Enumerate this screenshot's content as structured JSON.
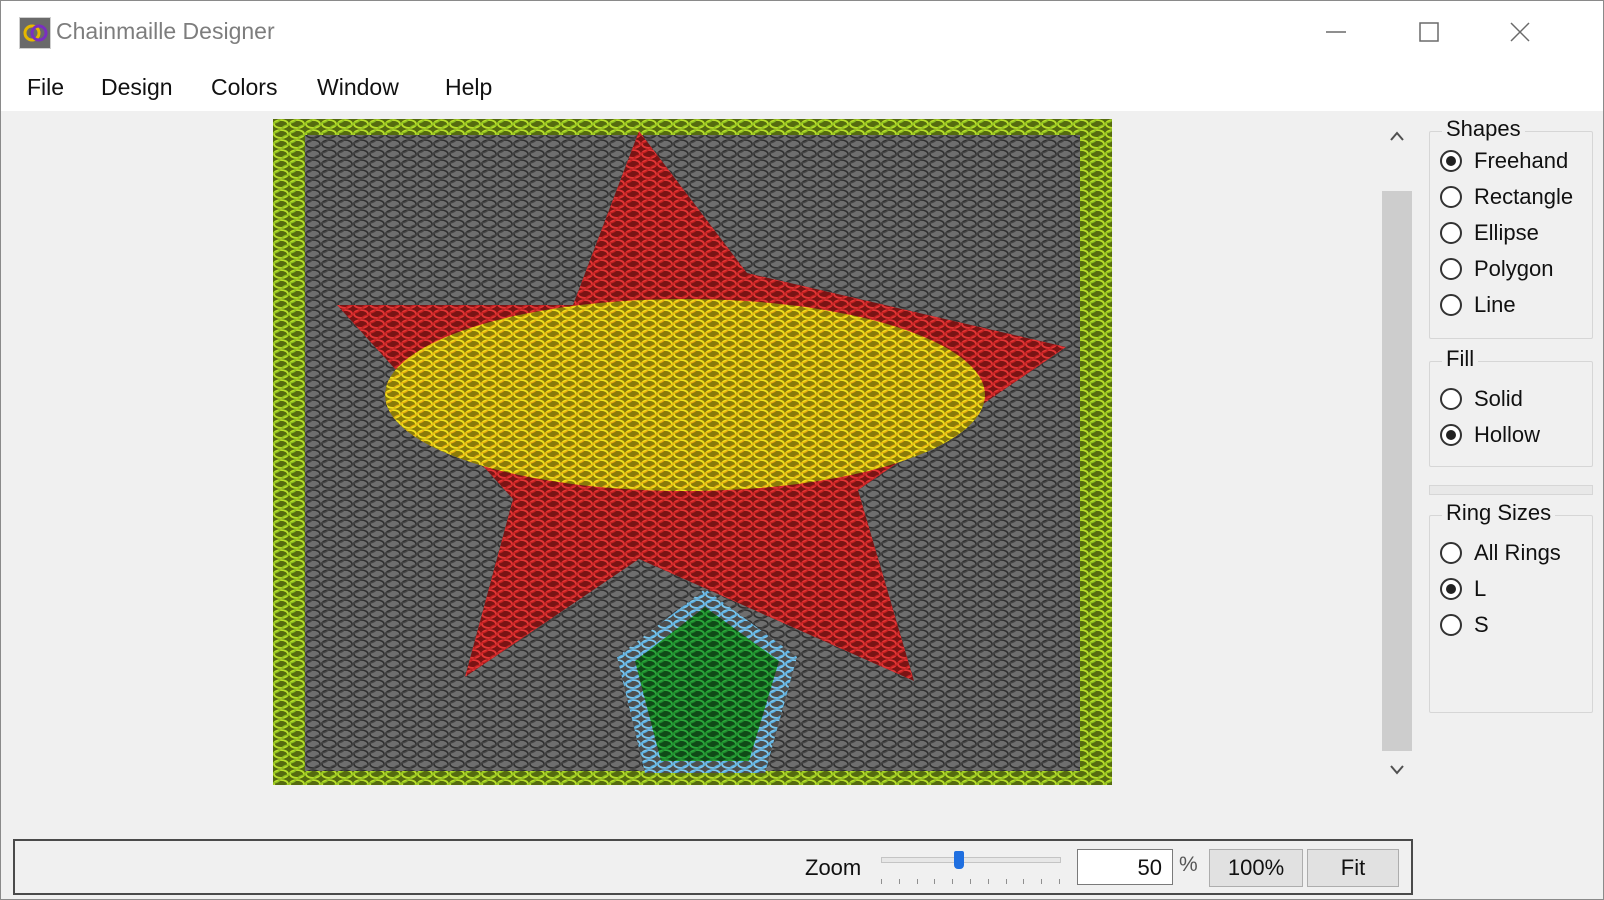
{
  "window": {
    "title": "Chainmaille Designer",
    "icons": {
      "app": "chainmaille-app-icon",
      "minimize": "minimize-icon",
      "maximize": "maximize-icon",
      "close": "close-icon"
    }
  },
  "menu": {
    "items": [
      "File",
      "Design",
      "Colors",
      "Window",
      "Help"
    ]
  },
  "canvas": {
    "icon_scroll_up": "chevron-up-icon",
    "icon_scroll_down": "chevron-down-icon",
    "colors": {
      "background_ring": "#3a3a3a",
      "border_ring": "#8fbf1f",
      "star_ring": "#d42a2a",
      "center_ring": "#e0c814",
      "tree_ring": "#1f8a2c",
      "tree_outline_ring": "#6ec0ea"
    }
  },
  "panels": {
    "shapes": {
      "title": "Shapes",
      "options": [
        "Freehand",
        "Rectangle",
        "Ellipse",
        "Polygon",
        "Line"
      ],
      "selected": "Freehand"
    },
    "fill": {
      "title": "Fill",
      "options": [
        "Solid",
        "Hollow"
      ],
      "selected": "Hollow"
    },
    "ring_sizes": {
      "title": "Ring Sizes",
      "options": [
        "All Rings",
        "L",
        "S"
      ],
      "selected": "L"
    }
  },
  "status": {
    "zoom_label": "Zoom",
    "zoom_value": "50",
    "zoom_slider_fraction": 0.44,
    "percent_sign": "%",
    "btn_100": "100%",
    "btn_fit": "Fit",
    "accent_color": "#1f6fe0"
  }
}
